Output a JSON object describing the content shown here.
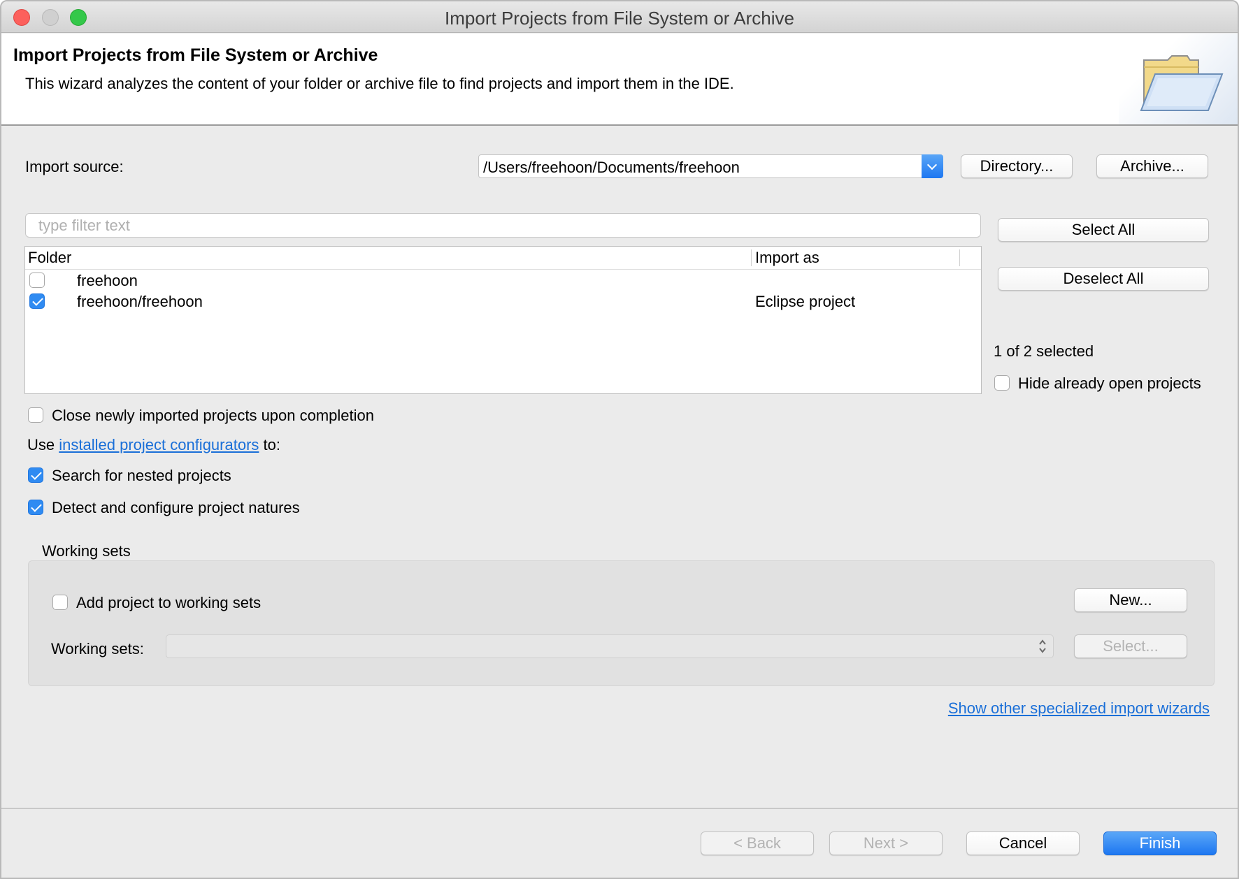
{
  "window": {
    "title": "Import Projects from File System or Archive"
  },
  "banner": {
    "title": "Import Projects from File System or Archive",
    "description": "This wizard analyzes the content of your folder or archive file to find projects and import them in the IDE.",
    "icon": "folder-icon"
  },
  "source": {
    "label": "Import source:",
    "value": "/Users/freehoon/Documents/freehoon",
    "directory_button": "Directory...",
    "archive_button": "Archive..."
  },
  "filter": {
    "placeholder": "type filter text",
    "value": ""
  },
  "table": {
    "columns": [
      "Folder",
      "Import as"
    ],
    "rows": [
      {
        "checked": false,
        "folder": "freehoon",
        "import_as": ""
      },
      {
        "checked": true,
        "folder": "freehoon/freehoon",
        "import_as": "Eclipse project"
      }
    ]
  },
  "selection": {
    "select_all": "Select All",
    "deselect_all": "Deselect All",
    "count_text": "1 of 2 selected",
    "hide_open_label": "Hide already open projects",
    "hide_open_checked": false
  },
  "options": {
    "close_imported_label": "Close newly imported projects upon completion",
    "close_imported_checked": false,
    "use_prefix": "Use",
    "configurators_link": "installed project configurators",
    "use_suffix": "to:",
    "search_nested_label": "Search for nested projects",
    "search_nested_checked": true,
    "detect_natures_label": "Detect and configure project natures",
    "detect_natures_checked": true
  },
  "working_sets": {
    "group_title": "Working sets",
    "add_label": "Add project to working sets",
    "add_checked": false,
    "new_button": "New...",
    "sets_label": "Working sets:",
    "sets_value": "",
    "select_button": "Select..."
  },
  "other_wizards_link": "Show other specialized import wizards",
  "footer": {
    "back": "< Back",
    "next": "Next >",
    "cancel": "Cancel",
    "finish": "Finish"
  },
  "colors": {
    "accent": "#2f8bf2",
    "link": "#1a6fd8",
    "close": "#fc605c",
    "maximize": "#34c84a"
  }
}
